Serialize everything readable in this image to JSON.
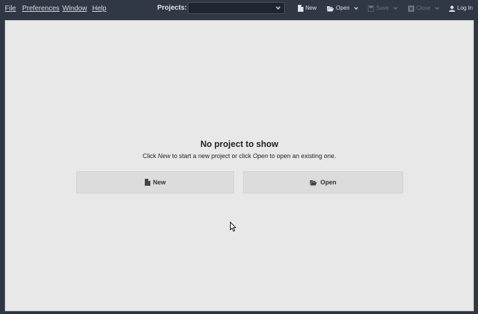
{
  "menubar": {
    "file": "File",
    "preferences": "Preferences",
    "window": "Window",
    "help": "Help"
  },
  "toolbar": {
    "projects_label": "Projects:",
    "projects_selected": "",
    "new_label": "New",
    "open_label": "Open",
    "save_label": "Save",
    "close_label": "Close",
    "login_label": "Log In"
  },
  "empty_state": {
    "title": "No project to show",
    "subtitle_prefix": "Click ",
    "subtitle_new": "New",
    "subtitle_middle": " to start a new project or click ",
    "subtitle_open": "Open",
    "subtitle_suffix": " to open an existing one.",
    "new_button": "New",
    "open_button": "Open"
  },
  "icons": {
    "new": "file-icon",
    "open": "folder-open-icon",
    "save": "floppy-icon",
    "close": "close-box-icon",
    "login": "user-icon",
    "dropdown": "chevron-down-icon"
  },
  "colors": {
    "topbar_bg": "#303845",
    "panel_bg": "#e8e8e8",
    "button_bg": "#dcdcdc",
    "disabled_text": "#6c7481"
  }
}
